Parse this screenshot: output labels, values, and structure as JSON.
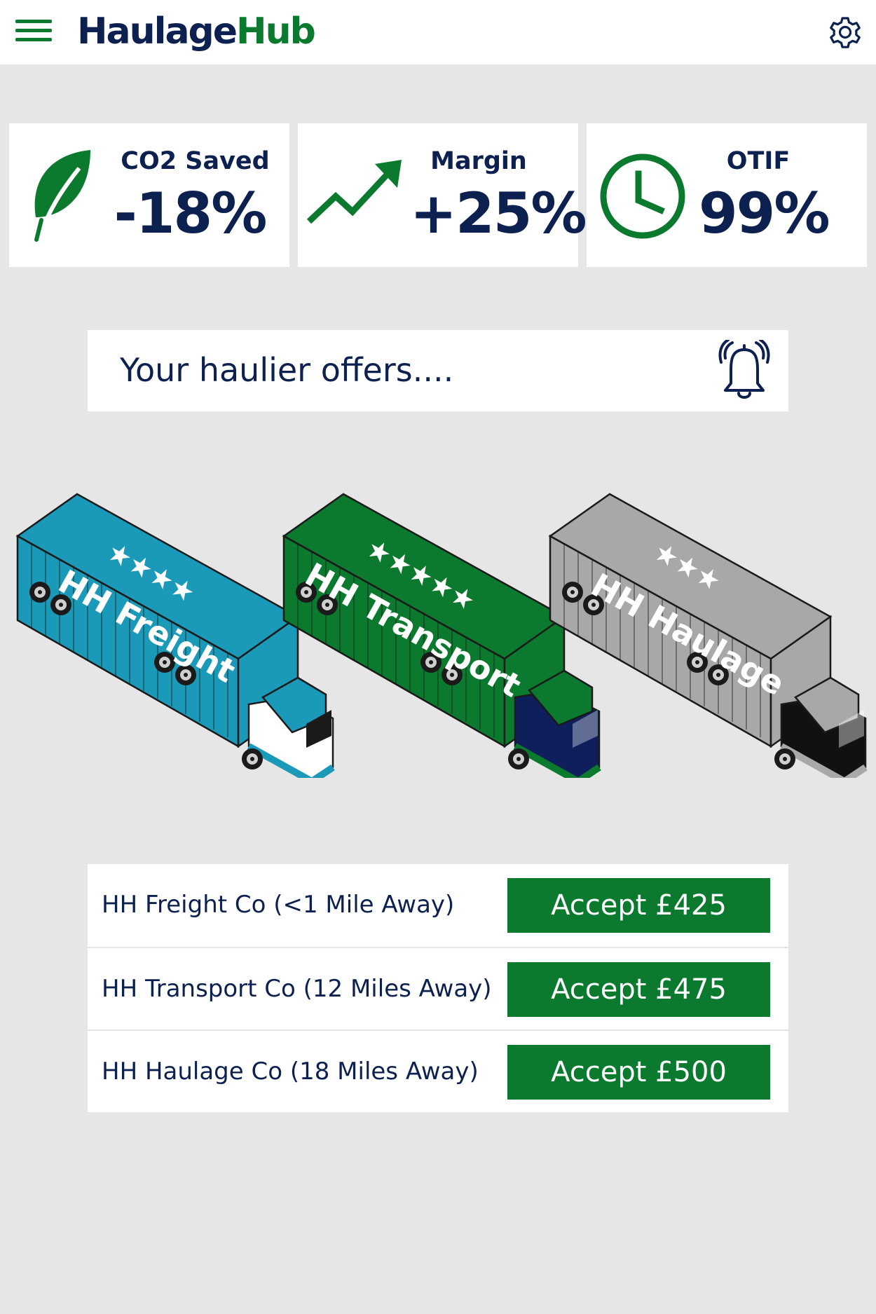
{
  "header": {
    "logo_part_a": "Haulage",
    "logo_part_b": "Hub",
    "menu_icon": "hamburger-menu-icon",
    "settings_icon": "gear-icon"
  },
  "kpis": [
    {
      "label": "CO2 Saved",
      "value": "-18%",
      "icon": "leaf-icon"
    },
    {
      "label": "Margin",
      "value": "+25%",
      "icon": "trend-up-icon"
    },
    {
      "label": "OTIF",
      "value": "99%",
      "icon": "clock-icon"
    }
  ],
  "banner": {
    "text": "Your haulier offers....",
    "icon": "bell-icon"
  },
  "trucks": [
    {
      "name": "HH Freight",
      "stars": "★★★★",
      "rating": 4,
      "color": "#1a9ab8"
    },
    {
      "name": "HH Transport",
      "stars": "★★★★★",
      "rating": 5,
      "color": "#0b7a2e"
    },
    {
      "name": "HH Haulage",
      "stars": "★★★",
      "rating": 3,
      "color": "#a8a8a8"
    }
  ],
  "offers": [
    {
      "company": "HH Freight Co (<1 Mile Away)",
      "accept_label": "Accept £425"
    },
    {
      "company": "HH Transport Co (12 Miles Away)",
      "accept_label": "Accept £475"
    },
    {
      "company": "HH Haulage Co (18 Miles Away)",
      "accept_label": "Accept £500"
    }
  ],
  "colors": {
    "brand_green": "#0b7a2e",
    "brand_navy": "#0d2151",
    "background": "#e6e6e6"
  }
}
